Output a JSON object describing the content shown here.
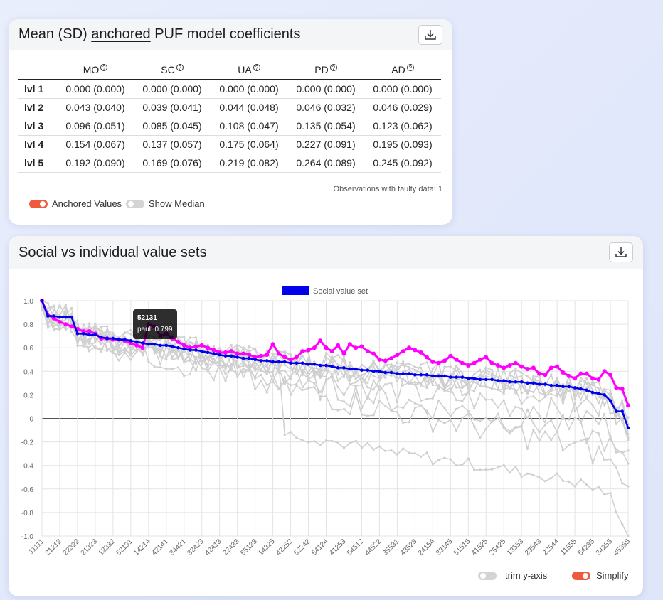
{
  "coef_card": {
    "title_parts": [
      "Mean (SD) ",
      "anchored",
      " PUF model coefficients"
    ],
    "columns": [
      "MO",
      "SC",
      "UA",
      "PD",
      "AD"
    ],
    "help_glyph": "?",
    "rows": [
      {
        "label": "lvl 1",
        "cells": [
          "0.000 (0.000)",
          "0.000 (0.000)",
          "0.000 (0.000)",
          "0.000 (0.000)",
          "0.000 (0.000)"
        ]
      },
      {
        "label": "lvl 2",
        "cells": [
          "0.043 (0.040)",
          "0.039 (0.041)",
          "0.044 (0.048)",
          "0.046 (0.032)",
          "0.046 (0.029)"
        ]
      },
      {
        "label": "lvl 3",
        "cells": [
          "0.096 (0.051)",
          "0.085 (0.045)",
          "0.108 (0.047)",
          "0.135 (0.054)",
          "0.123 (0.062)"
        ]
      },
      {
        "label": "lvl 4",
        "cells": [
          "0.154 (0.067)",
          "0.137 (0.057)",
          "0.175 (0.064)",
          "0.227 (0.091)",
          "0.195 (0.093)"
        ]
      },
      {
        "label": "lvl 5",
        "cells": [
          "0.192 (0.090)",
          "0.169 (0.076)",
          "0.219 (0.082)",
          "0.264 (0.089)",
          "0.245 (0.092)"
        ]
      }
    ],
    "observations_note": "Observations with faulty data: 1",
    "toggle_anchored": {
      "label": "Anchored Values",
      "on": true
    },
    "toggle_median": {
      "label": "Show Median",
      "on": false
    }
  },
  "chart_card": {
    "title": "Social vs individual value sets",
    "toggle_trim": {
      "label": "trim y-axis",
      "on": false
    },
    "toggle_simplify": {
      "label": "Simplify",
      "on": true
    },
    "tooltip": {
      "title": "52131",
      "line": "paul: 0.799"
    }
  },
  "colors": {
    "social": "#0000ee",
    "highlight": "#ff00ff",
    "others": "#cccccc",
    "toggle_on": "#f05a3c"
  },
  "icons": {
    "download": "download-icon",
    "help": "help-circle-icon"
  },
  "chart_data": {
    "type": "line",
    "legend": [
      {
        "label": "Social value set",
        "color": "#0000ee"
      }
    ],
    "legend_placement": "top-center",
    "ylim": [
      -1.0,
      1.0
    ],
    "yticks": [
      "1.0",
      "0.8",
      "0.6",
      "0.4",
      "0.2",
      "0",
      "-0.2",
      "-0.4",
      "-0.6",
      "-0.8",
      "-1.0"
    ],
    "grid": true,
    "xtick_labels": [
      "11111",
      "21212",
      "22322",
      "21323",
      "12332",
      "52131",
      "14214",
      "42141",
      "34421",
      "32423",
      "42413",
      "22433",
      "55123",
      "14325",
      "42252",
      "52242",
      "54124",
      "41253",
      "54512",
      "44522",
      "35531",
      "43523",
      "24154",
      "33145",
      "51515",
      "41525",
      "25425",
      "13553",
      "23543",
      "22544",
      "11555",
      "54235",
      "34255",
      "45355"
    ],
    "n_points": 100,
    "series": [
      {
        "name": "Social value set",
        "color": "#0000ee",
        "values": [
          1.0,
          0.87,
          0.87,
          0.86,
          0.86,
          0.86,
          0.72,
          0.72,
          0.71,
          0.71,
          0.69,
          0.68,
          0.68,
          0.67,
          0.67,
          0.66,
          0.65,
          0.64,
          0.63,
          0.63,
          0.62,
          0.62,
          0.61,
          0.6,
          0.59,
          0.58,
          0.58,
          0.57,
          0.56,
          0.55,
          0.54,
          0.53,
          0.53,
          0.52,
          0.51,
          0.51,
          0.5,
          0.49,
          0.49,
          0.48,
          0.48,
          0.48,
          0.47,
          0.47,
          0.47,
          0.46,
          0.46,
          0.45,
          0.45,
          0.44,
          0.43,
          0.43,
          0.42,
          0.42,
          0.41,
          0.41,
          0.4,
          0.4,
          0.39,
          0.39,
          0.38,
          0.38,
          0.38,
          0.37,
          0.37,
          0.37,
          0.36,
          0.36,
          0.36,
          0.35,
          0.35,
          0.35,
          0.34,
          0.34,
          0.33,
          0.33,
          0.33,
          0.32,
          0.32,
          0.31,
          0.31,
          0.31,
          0.3,
          0.3,
          0.29,
          0.29,
          0.28,
          0.28,
          0.27,
          0.27,
          0.26,
          0.25,
          0.24,
          0.22,
          0.21,
          0.2,
          0.15,
          0.06,
          0.06,
          -0.08
        ]
      },
      {
        "name": "paul",
        "color": "#ff00ff",
        "values": [
          1.0,
          0.88,
          0.85,
          0.82,
          0.8,
          0.78,
          0.76,
          0.74,
          0.74,
          0.72,
          0.68,
          0.68,
          0.67,
          0.67,
          0.66,
          0.64,
          0.62,
          0.6,
          0.8,
          0.78,
          0.7,
          0.72,
          0.68,
          0.65,
          0.62,
          0.6,
          0.61,
          0.62,
          0.6,
          0.58,
          0.56,
          0.56,
          0.57,
          0.55,
          0.55,
          0.54,
          0.52,
          0.53,
          0.54,
          0.63,
          0.55,
          0.52,
          0.5,
          0.52,
          0.57,
          0.58,
          0.6,
          0.66,
          0.6,
          0.57,
          0.62,
          0.55,
          0.63,
          0.6,
          0.61,
          0.57,
          0.55,
          0.5,
          0.49,
          0.51,
          0.54,
          0.57,
          0.6,
          0.58,
          0.56,
          0.52,
          0.48,
          0.47,
          0.49,
          0.53,
          0.5,
          0.47,
          0.45,
          0.47,
          0.5,
          0.52,
          0.47,
          0.45,
          0.43,
          0.45,
          0.47,
          0.44,
          0.42,
          0.43,
          0.38,
          0.37,
          0.43,
          0.44,
          0.39,
          0.36,
          0.34,
          0.38,
          0.38,
          0.34,
          0.33,
          0.4,
          0.37,
          0.26,
          0.25,
          0.11
        ]
      }
    ]
  }
}
